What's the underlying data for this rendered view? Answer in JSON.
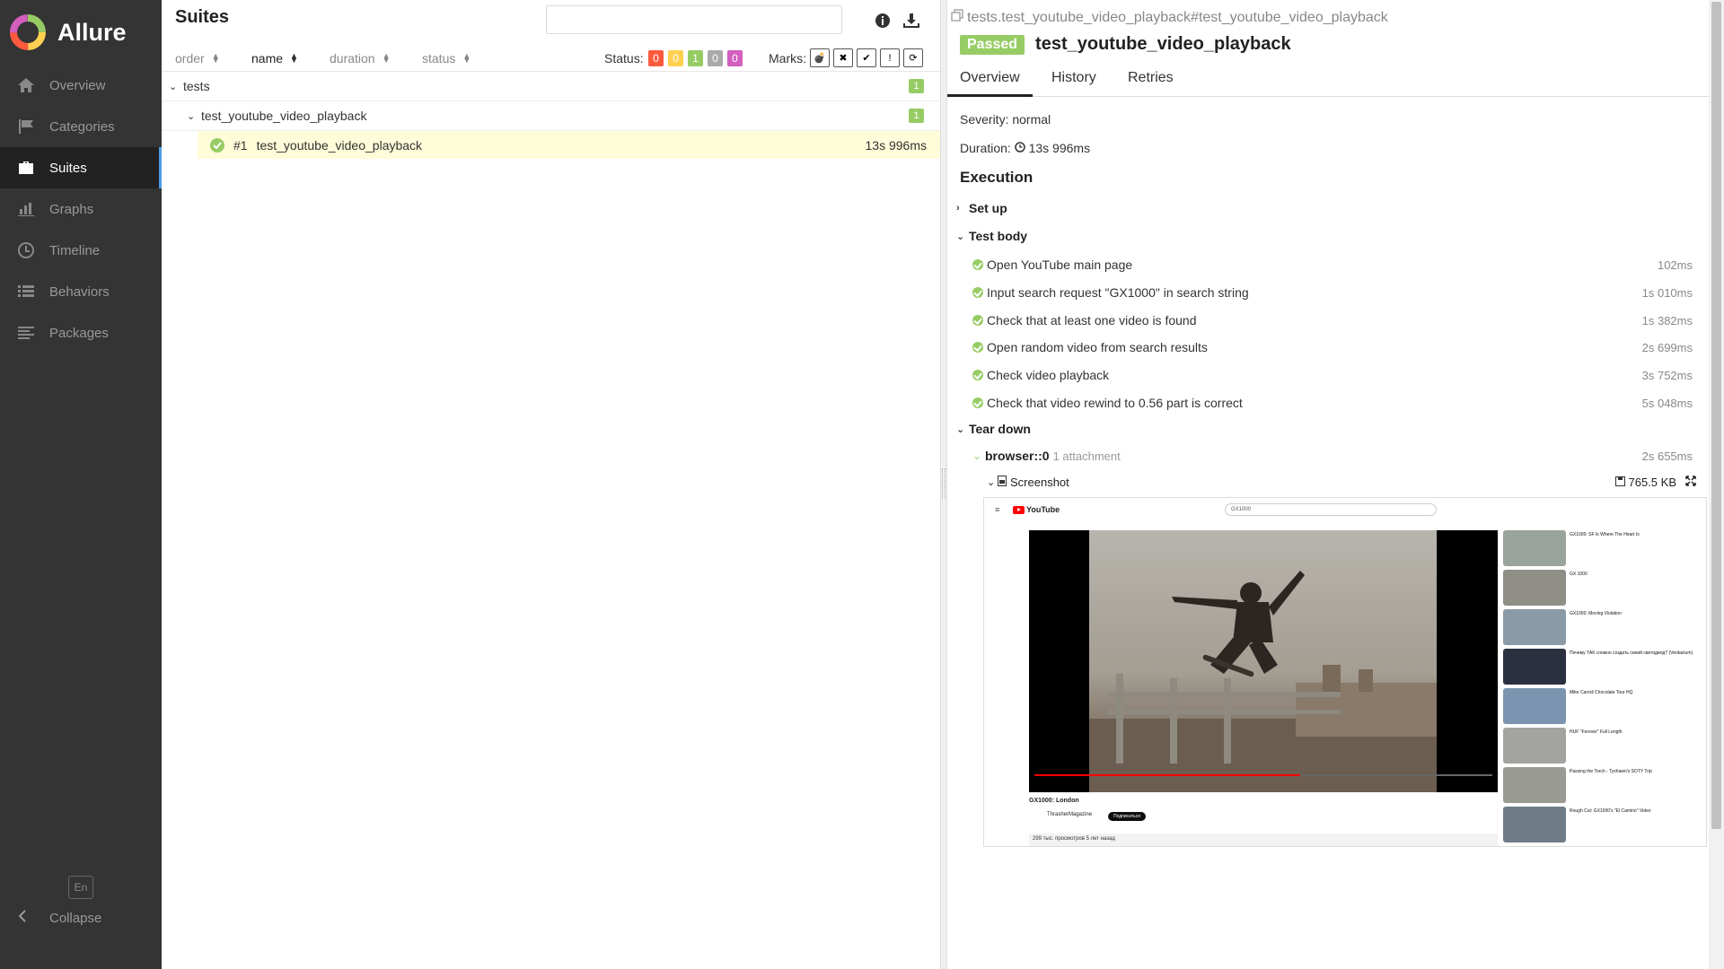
{
  "app": {
    "name": "Allure"
  },
  "sidebar": {
    "items": [
      {
        "label": "Overview",
        "icon": "home-icon",
        "active": false
      },
      {
        "label": "Categories",
        "icon": "flag-icon",
        "active": false
      },
      {
        "label": "Suites",
        "icon": "briefcase-icon",
        "active": true
      },
      {
        "label": "Graphs",
        "icon": "bar-chart-icon",
        "active": false
      },
      {
        "label": "Timeline",
        "icon": "clock-icon",
        "active": false
      },
      {
        "label": "Behaviors",
        "icon": "list-icon",
        "active": false
      },
      {
        "label": "Packages",
        "icon": "align-left-icon",
        "active": false
      }
    ],
    "language": "En",
    "collapse_label": "Collapse"
  },
  "suites": {
    "title": "Suites",
    "search_value": "",
    "sort": {
      "order": "order",
      "name": "name",
      "duration": "duration",
      "status": "status"
    },
    "status_label": "Status:",
    "status_counts": [
      {
        "value": "0",
        "color": "#fd5a3e"
      },
      {
        "value": "0",
        "color": "#ffd050"
      },
      {
        "value": "1",
        "color": "#97cc64"
      },
      {
        "value": "0",
        "color": "#aaaaaa"
      },
      {
        "value": "0",
        "color": "#d35ebe"
      }
    ],
    "marks_label": "Marks:",
    "tree": {
      "root": {
        "name": "tests",
        "count": "1"
      },
      "suite": {
        "name": "test_youtube_video_playback",
        "count": "1"
      },
      "test": {
        "num": "#1",
        "name": "test_youtube_video_playback",
        "duration": "13s 996ms"
      }
    }
  },
  "detail": {
    "breadcrumb": "tests.test_youtube_video_playback#test_youtube_video_playback",
    "status": "Passed",
    "title": "test_youtube_video_playback",
    "tabs": [
      "Overview",
      "History",
      "Retries"
    ],
    "severity_label": "Severity:",
    "severity": "normal",
    "duration_label": "Duration:",
    "duration": "13s 996ms",
    "execution_title": "Execution",
    "setup_label": "Set up",
    "body_label": "Test body",
    "steps": [
      {
        "name": "Open YouTube main page",
        "duration": "102ms"
      },
      {
        "name": "Input search request \"GX1000\" in search string",
        "duration": "1s 010ms"
      },
      {
        "name": "Check that at least one video is found",
        "duration": "1s 382ms"
      },
      {
        "name": "Open random video from search results",
        "duration": "2s 699ms"
      },
      {
        "name": "Check video playback",
        "duration": "3s 752ms"
      },
      {
        "name": "Check that video rewind to 0.56 part is correct",
        "duration": "5s 048ms"
      }
    ],
    "teardown_label": "Tear down",
    "teardown_item": {
      "name": "browser::0",
      "meta": "1 attachment",
      "duration": "2s 655ms"
    },
    "attachment": {
      "name": "Screenshot",
      "size": "765.5 KB"
    },
    "screenshot": {
      "logo": "YouTube",
      "search": "GX1000",
      "video_title": "GX1000: London",
      "channel": "ThrasherMagazine",
      "subscribe": "Подписаться",
      "views": "299 тыс. просмотров 5 лет назад",
      "progress": 0.58,
      "side_titles": [
        "GX1000: SF Is Where The Heart Is",
        "GX 1000",
        "GX1000: Moving Violation",
        "Почему ТАК сложно создать синий светодиод? (Veritasium)",
        "Mike Carroll Chocolate Tour HQ",
        "HUF \"Forever\" Full Length",
        "Passing the Torch - Tyshawn's SOTY Trip",
        "Rough Cut: GX1000's \"El Camino\" Video"
      ]
    }
  }
}
